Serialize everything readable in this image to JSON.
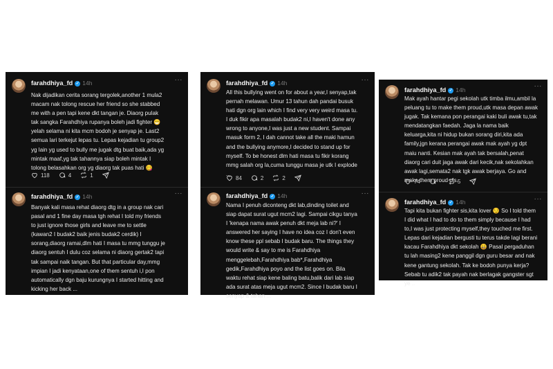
{
  "colors": {
    "background": "#ffffff",
    "card": "#101010",
    "verified": "#1d9bf0",
    "muted": "#7a7a7a"
  },
  "columns": [
    {
      "posts": [
        {
          "username": "farahdhiya_fd",
          "time": "14h",
          "text": "Nak dijadikan cerita sorang tergolek,another 1 mula2\nmacam nak tolong rescue her friend so she stabbed\nme with a pen tapi kene dkt tangan je. Diaorg pulak\ntak sangka Farahdhiya rupanya boleh jadi fighter 😁\nyelah selama ni kita mcm bodoh je senyap je. Last2\nsemua lari terkejut lepas tu. Lepas kejadian tu group2\nyg lain yg used to bully me jugak dtg buat baik,ada yg\nmintak maaf,yg tak tahannya siap boleh mintak I\ntolong belasahkan org yg diaorg tak puas hati 😋",
          "likes": "118",
          "replies": "4",
          "reposts": "1"
        },
        {
          "username": "farahdhiya_fd",
          "time": "14h",
          "text": "Banyak kali masa rehat diaorg dtg in a group nak cari\npasal and 1 fine day masa tgh rehat I told my friends\nto just ignore those girls and leave me to settle\n(kawan2 I budak2 baik jenis budak2 cerdik) I\nsorang,diaorg ramai,dlm hati I masa tu mmg tunggu je\ndiaorg sentuh I dulu coz selama ni diaorg gertak2 tapi\ntak sampai naik tangan. But that particular day,mmg\nimpian I jadi kenyataan,one of them sentuh i,I pon\nautomatically dgn baju kurungnya I started hitting and\nkicking her back ..."
        }
      ]
    },
    {
      "posts": [
        {
          "username": "farahdhiya_fd",
          "time": "14h",
          "text": "All this bullying went on for about a year,I senyap,tak\npernah melawan. Umur 13 tahun dah pandai busuk\nhati dgn org lain which I find very very weird masa tu.\nI duk fikir apa masalah budak2 ni,I haven't done any\nwrong to anyone,I was just a new student. Sampai\nmasuk form 2, I dah cannot take all the maki hamun\nand the bullying anymore,I decided to stand up for\nmyself. To be honest dlm hati masa tu fikir korang\nmmg salah org la,cuma tunggu masa je utk I explode\n...",
          "likes": "84",
          "replies": "2",
          "reposts": "2"
        },
        {
          "username": "farahdhiya_fd",
          "time": "14h",
          "text": "Nama I penuh diconteng dkt lab,dinding toilet and\nsiap dapat surat ugut mcm2 lagi. Sampai cikgu tanya\nI 'kenapa nama awak penuh dkt meja lab ni?' I\nanswered her saying I have no idea coz I don't even\nknow these ppl sebab I budak baru. The things they\nwould write & say to me is Farahdhiya\nmenggelebah,Farahdhiya bab*,Farahdhiya\ngedik,Farahdhiya poyo and the list goes on. Bila\nwaktu rehat siap kene baling batu,balik dari lab siap\nada surat atas meja ugut mcm2. Since I budak baru I\nsenyap & tahan ..."
        }
      ]
    },
    {
      "posts": [
        {
          "username": "farahdhiya_fd",
          "time": "14h",
          "text": "Mak ayah hantar pegi sekolah utk timba ilmu,ambil la\npeluang tu to make them proud,utk masa depan awak\njugak. Tak kemana pon perangai kaki buli awak tu,tak\nmendatangkan faedah. Jaga la nama baik\nkeluarga,kita ni hidup bukan sorang diri,kita ada\nfamily,jgn kerana perangai awak mak ayah yg dpt\nmaiu nanti. Kesian mak ayah tak bersalah,penat\ndiaorg cari duit jaga awak dari kecik,nak sekolahkan\nawak lagi,semata2 nak tgk awak berjaya. Go and\nmake them proud pls.",
          "likes": "74",
          "replies": "",
          "reposts": "5"
        },
        {
          "username": "farahdhiya_fd",
          "time": "14h",
          "text": "Tapi kita bukan fighter sis,kita lover 😏 So I told them\nI did what I had to do to them simply because I had\nto,I was just protecting myself,they touched me first.\nLepas dari kejadian bergusti tu terus takde lagi berani\nkacau Farahdhiya dkt sekolah 😄 Pasal pergaduhan\ntu lah masing2 kene panggil dgn guru besar and nak\nkene gantung sekolah. Tak ke bodoh punya kerja?\nSebab tu adik2 tak payah nak berlagak gangster sgt\nye .."
        }
      ]
    }
  ]
}
